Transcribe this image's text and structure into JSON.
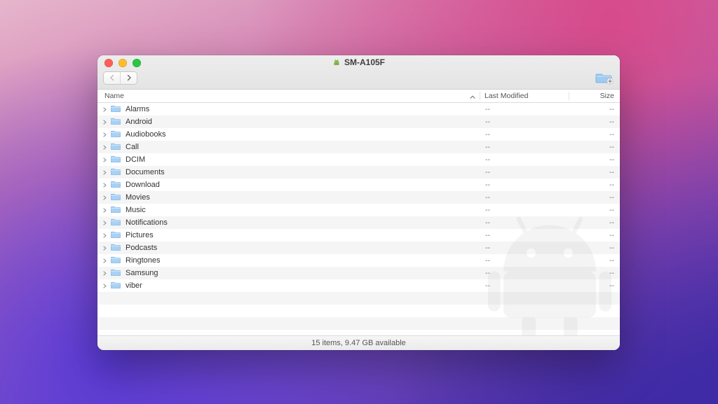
{
  "window": {
    "title": "SM-A105F"
  },
  "columns": {
    "name": "Name",
    "modified": "Last Modified",
    "size": "Size"
  },
  "rows": [
    {
      "name": "Alarms",
      "modified": "--",
      "size": "--"
    },
    {
      "name": "Android",
      "modified": "--",
      "size": "--"
    },
    {
      "name": "Audiobooks",
      "modified": "--",
      "size": "--"
    },
    {
      "name": "Call",
      "modified": "--",
      "size": "--"
    },
    {
      "name": "DCIM",
      "modified": "--",
      "size": "--"
    },
    {
      "name": "Documents",
      "modified": "--",
      "size": "--"
    },
    {
      "name": "Download",
      "modified": "--",
      "size": "--"
    },
    {
      "name": "Movies",
      "modified": "--",
      "size": "--"
    },
    {
      "name": "Music",
      "modified": "--",
      "size": "--"
    },
    {
      "name": "Notifications",
      "modified": "--",
      "size": "--"
    },
    {
      "name": "Pictures",
      "modified": "--",
      "size": "--"
    },
    {
      "name": "Podcasts",
      "modified": "--",
      "size": "--"
    },
    {
      "name": "Ringtones",
      "modified": "--",
      "size": "--"
    },
    {
      "name": "Samsung",
      "modified": "--",
      "size": "--"
    },
    {
      "name": "viber",
      "modified": "--",
      "size": "--"
    }
  ],
  "status": "15 items, 9.47 GB available"
}
